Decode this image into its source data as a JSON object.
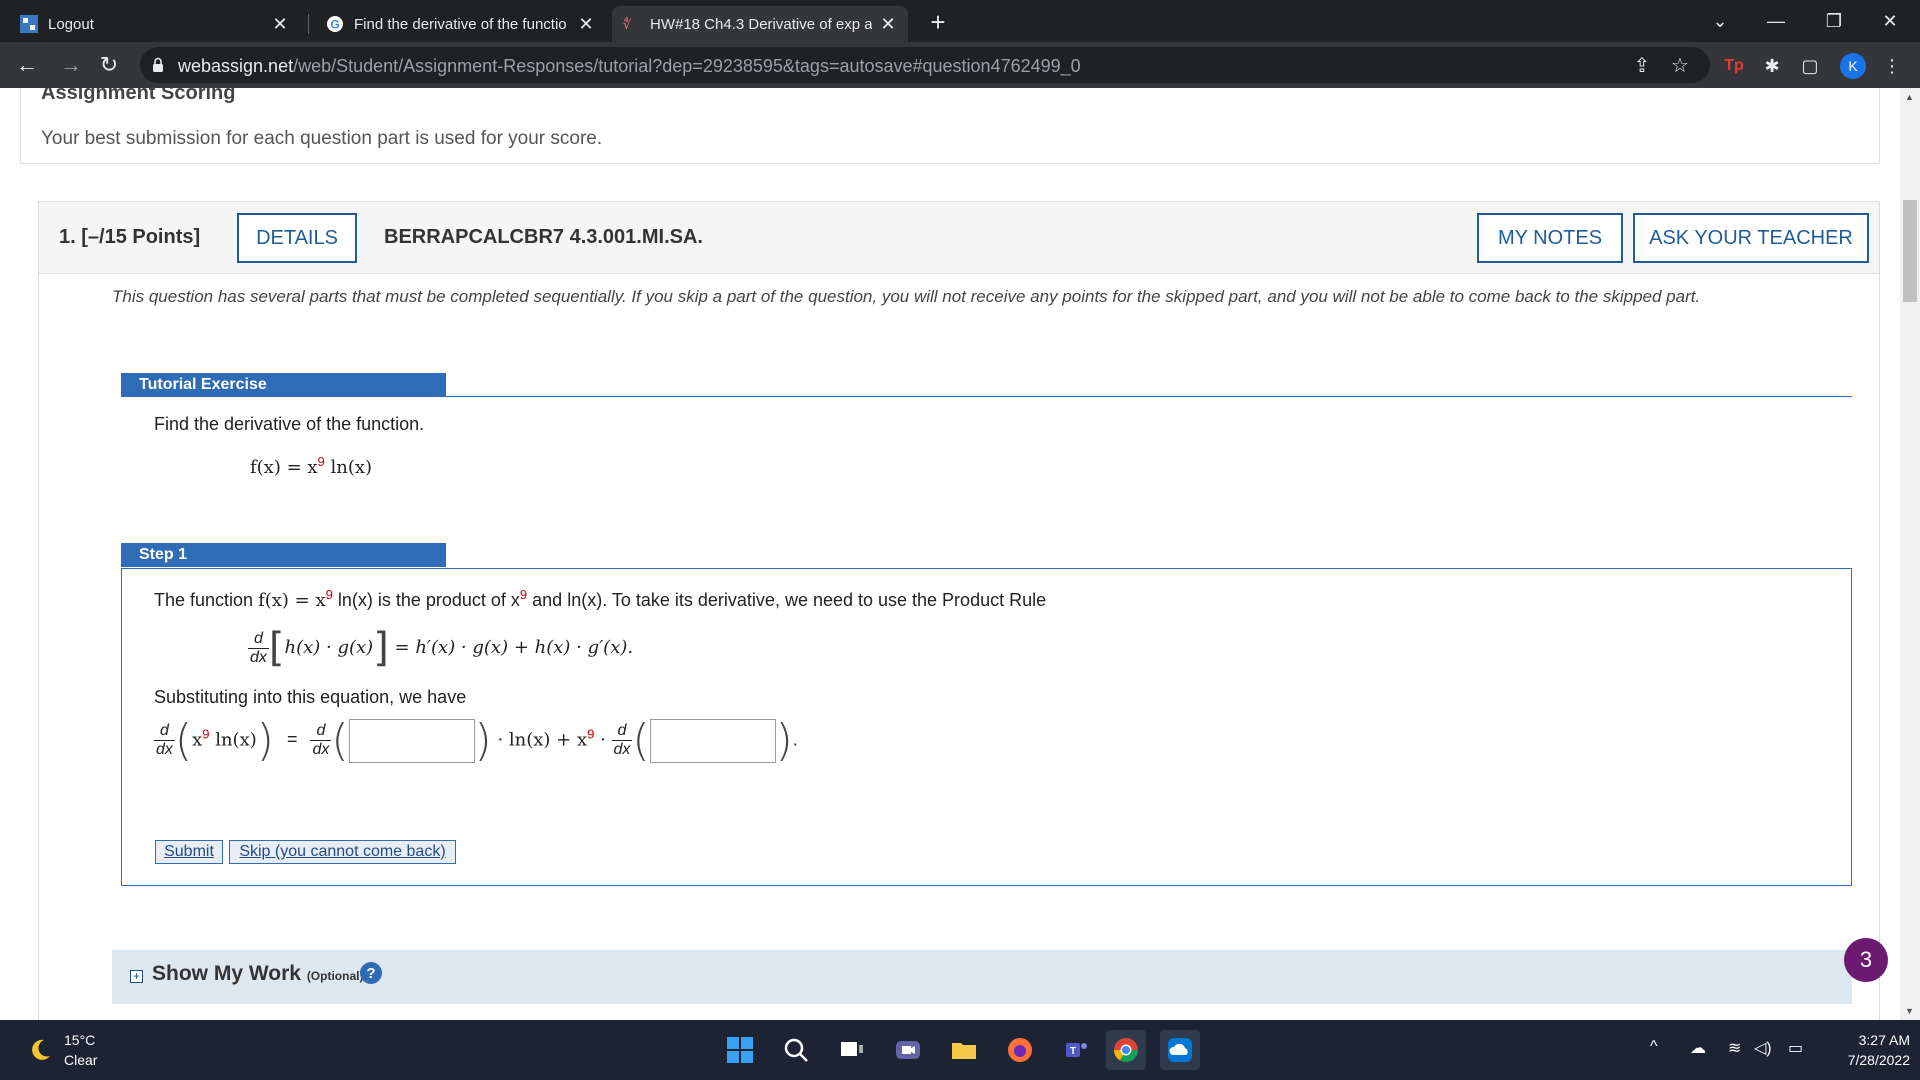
{
  "browser": {
    "tabs": [
      {
        "title": "Logout",
        "active": false
      },
      {
        "title": "Find the derivative of the functio",
        "active": false
      },
      {
        "title": "HW#18 Ch4.3 Derivative of exp a",
        "active": true
      }
    ],
    "url_host": "webassign.net",
    "url_path": "/web/Student/Assignment-Responses/tutorial?dep=29238595&tags=autosave#question4762499_0",
    "profile_initial": "K",
    "ext_tp_label": "Tp"
  },
  "scoring": {
    "title": "Assignment Scoring",
    "description": "Your best submission for each question part is used for your score."
  },
  "question": {
    "number": "1. [–/15 Points]",
    "details_label": "DETAILS",
    "code": "BERRAPCALCBR7 4.3.001.MI.SA.",
    "my_notes_label": "MY NOTES",
    "ask_teacher_label": "ASK YOUR TEACHER",
    "instructions": "This question has several parts that must be completed sequentially. If you skip a part of the question, you will not receive any points for the skipped part, and you will not be able to come back to the skipped part."
  },
  "tutorial": {
    "section_label": "Tutorial Exercise",
    "prompt": "Find the derivative of the function.",
    "func_lhs": "f(x) = x",
    "func_exp": "9",
    "func_rhs": " ln(x)"
  },
  "step1": {
    "label": "Step 1",
    "text_a": "The function ",
    "text_fx": "f(x) = x",
    "text_exp": "9",
    "text_b": " ln(x) is the product of x",
    "text_exp2": "9",
    "text_c": " and ln(x). To take its derivative, we need to use the Product Rule",
    "rule_d": "d",
    "rule_dx": "dx",
    "rule_inner": "h(x) · g(x)",
    "rule_rhs": " = h′(x) · g(x) + h(x) · g′(x).",
    "subst_text": "Substituting into this equation, we have",
    "eq_inner_base": "x",
    "eq_inner_exp": "9",
    "eq_inner_rest": " ln(x)",
    "eq_equals": "=",
    "eq_mid": " · ln(x) + x",
    "eq_mid_exp": "9",
    "eq_mid_dot": " · ",
    "eq_end": ".",
    "submit_label": "Submit",
    "skip_label": "Skip (you cannot come back)"
  },
  "show_work": {
    "label": "Show My Work",
    "optional": "(Optional)",
    "help": "?"
  },
  "badge_count": "3",
  "taskbar": {
    "temp": "15°C",
    "condition": "Clear",
    "time": "3:27 AM",
    "date": "7/28/2022"
  },
  "colors": {
    "accent": "#2e6cb5",
    "button_border": "#1f5c99",
    "exponent": "#cc0000",
    "badge": "#6a1b6f"
  }
}
